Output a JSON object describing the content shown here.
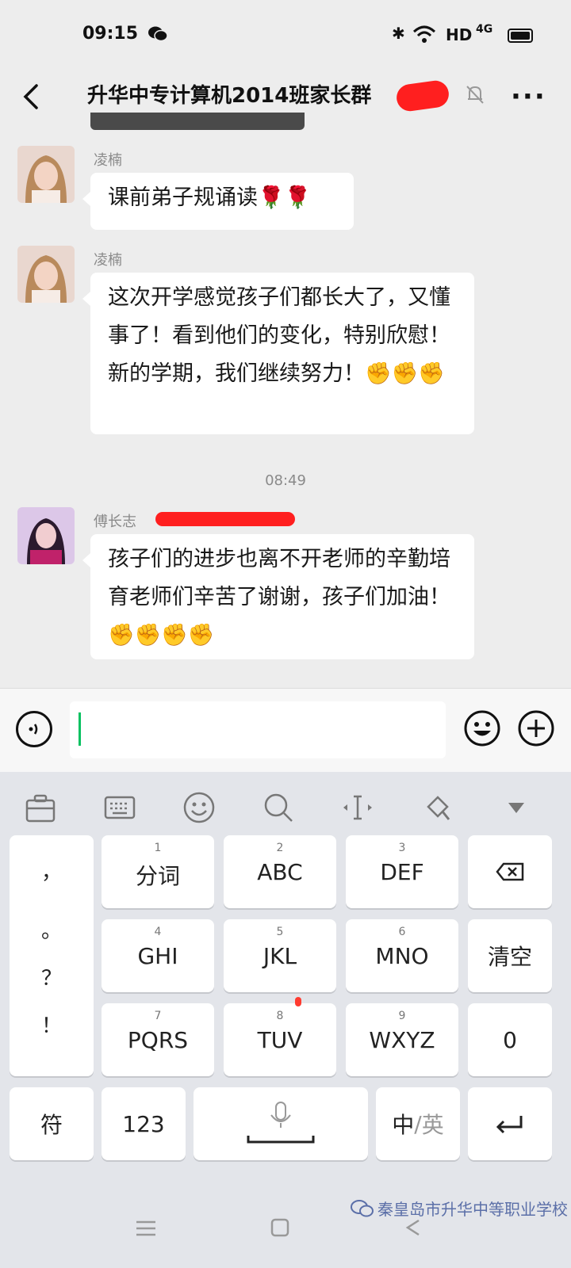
{
  "status_bar": {
    "time": "09:15",
    "network_label": "HD",
    "network_type": "4G"
  },
  "header": {
    "title": "升华中专计算机2014班家长群",
    "back_icon": "back-arrow-icon",
    "mute_icon": "bell-muted-icon",
    "more_label": "···"
  },
  "messages": [
    {
      "sender": "凌楠",
      "text": "课前弟子规诵读🌹🌹"
    },
    {
      "sender": "凌楠",
      "text": "这次开学感觉孩子们都长大了，又懂事了！看到他们的变化，特别欣慰！新的学期，我们继续努力！✊✊✊"
    },
    {
      "sender": "傅长志",
      "text": "孩子们的进步也离不开老师的辛勤培育老师们辛苦了谢谢，孩子们加油！✊✊✊✊"
    }
  ],
  "time_separator": "08:49",
  "keyboard": {
    "punct": [
      "，",
      "。",
      "？",
      "！"
    ],
    "keys": [
      {
        "num": "1",
        "label": "分词"
      },
      {
        "num": "2",
        "label": "ABC"
      },
      {
        "num": "3",
        "label": "DEF"
      },
      {
        "num": "4",
        "label": "GHI"
      },
      {
        "num": "5",
        "label": "JKL"
      },
      {
        "num": "6",
        "label": "MNO"
      },
      {
        "num": "7",
        "label": "PQRS"
      },
      {
        "num": "8",
        "label": "TUV"
      },
      {
        "num": "9",
        "label": "WXYZ"
      }
    ],
    "clear": "清空",
    "zero": "0",
    "symbols": "符",
    "numbers": "123",
    "lang_cn": "中",
    "lang_sep": "/",
    "lang_en": "英"
  },
  "watermark": "秦皇岛市升华中等职业学校",
  "colors": {
    "accent": "#07c160",
    "redact": "#ff1f1f"
  }
}
